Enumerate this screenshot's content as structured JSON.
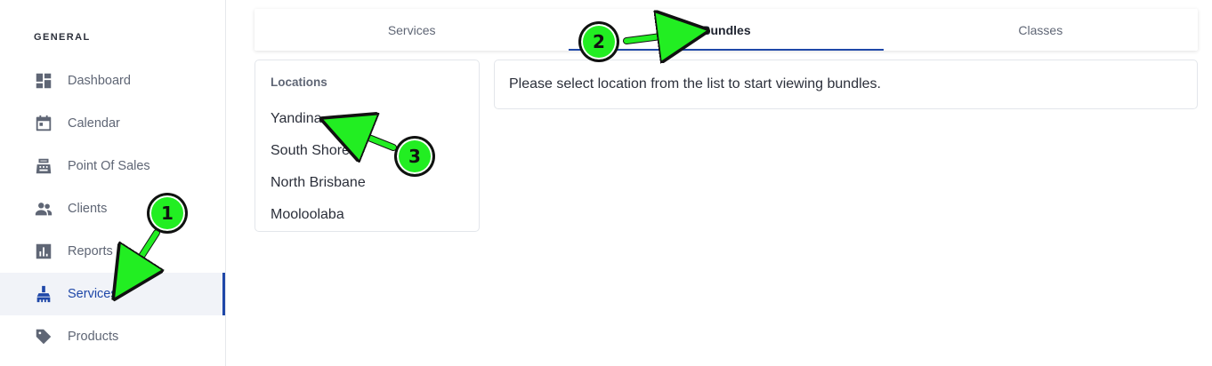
{
  "sidebar": {
    "heading": "GENERAL",
    "items": [
      {
        "label": "Dashboard",
        "icon": "dashboard-icon"
      },
      {
        "label": "Calendar",
        "icon": "calendar-icon"
      },
      {
        "label": "Point Of Sales",
        "icon": "cash-register-icon"
      },
      {
        "label": "Clients",
        "icon": "people-icon"
      },
      {
        "label": "Reports",
        "icon": "bar-chart-icon"
      },
      {
        "label": "Services",
        "icon": "brush-icon",
        "active": true
      },
      {
        "label": "Products",
        "icon": "tag-icon"
      }
    ]
  },
  "tabs": [
    {
      "label": "Services"
    },
    {
      "label": "Bundles",
      "active": true
    },
    {
      "label": "Classes"
    }
  ],
  "locations": {
    "title": "Locations",
    "items": [
      "Yandina",
      "South Shore",
      "North Brisbane",
      "Mooloolaba"
    ]
  },
  "message": "Please select location from the list to start viewing bundles.",
  "annotations": {
    "color": "#22ee22",
    "badges": [
      "1",
      "2",
      "3"
    ]
  },
  "colors": {
    "accent": "#1f47a8",
    "muted_text": "#5f6675",
    "active_bg": "#f1f3f8"
  }
}
